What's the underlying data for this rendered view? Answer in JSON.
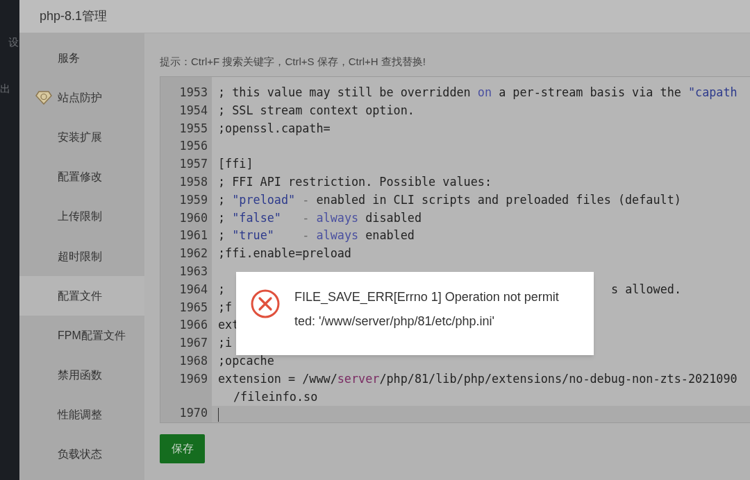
{
  "background": {
    "texts": [
      "设",
      "出"
    ]
  },
  "window": {
    "title": "php-8.1管理"
  },
  "sidebar": {
    "items": [
      {
        "label": "服务",
        "selected": false
      },
      {
        "label": "站点防护",
        "selected": false,
        "kind": "premium"
      },
      {
        "label": "安装扩展",
        "selected": false
      },
      {
        "label": "配置修改",
        "selected": false
      },
      {
        "label": "上传限制",
        "selected": false
      },
      {
        "label": "超时限制",
        "selected": false
      },
      {
        "label": "配置文件",
        "selected": true
      },
      {
        "label": "FPM配置文件",
        "selected": false
      },
      {
        "label": "禁用函数",
        "selected": false
      },
      {
        "label": "性能调整",
        "selected": false
      },
      {
        "label": "负载状态",
        "selected": false
      }
    ]
  },
  "hint": "提示：Ctrl+F 搜索关键字，Ctrl+S 保存，Ctrl+H 查找替换!",
  "editor": {
    "lines": [
      {
        "number": "1953",
        "active": false,
        "segments": [
          {
            "text": "; this value may still be overridden ",
            "kind": "plain"
          },
          {
            "text": "on",
            "kind": "keyword"
          },
          {
            "text": " a per-stream basis via the ",
            "kind": "plain"
          },
          {
            "text": "\"capath",
            "kind": "string"
          }
        ]
      },
      {
        "number": "1954",
        "active": false,
        "segments": [
          {
            "text": "; SSL stream context option.",
            "kind": "plain"
          }
        ]
      },
      {
        "number": "1955",
        "active": false,
        "segments": [
          {
            "text": ";openssl.capath=",
            "kind": "plain"
          }
        ]
      },
      {
        "number": "1956",
        "active": false
      },
      {
        "number": "1957",
        "active": false,
        "segments": [
          {
            "text": "[ffi]",
            "kind": "plain"
          }
        ]
      },
      {
        "number": "1958",
        "active": false,
        "segments": [
          {
            "text": "; FFI API restriction. Possible values:",
            "kind": "plain"
          }
        ]
      },
      {
        "number": "1959",
        "active": false,
        "segments": [
          {
            "text": "; ",
            "kind": "plain"
          },
          {
            "text": "\"preload\"",
            "kind": "string"
          },
          {
            "text": " -",
            "kind": "operator"
          },
          {
            "text": " enabled in CLI scripts and preloaded files (default)",
            "kind": "plain"
          }
        ]
      },
      {
        "number": "1960",
        "active": false,
        "segments": [
          {
            "text": "; ",
            "kind": "plain"
          },
          {
            "text": "\"false\"",
            "kind": "string"
          },
          {
            "text": "   - ",
            "kind": "operator"
          },
          {
            "text": "always",
            "kind": "keyword"
          },
          {
            "text": " disabled",
            "kind": "plain"
          }
        ]
      },
      {
        "number": "1961",
        "active": false,
        "segments": [
          {
            "text": "; ",
            "kind": "plain"
          },
          {
            "text": "\"true\"",
            "kind": "string"
          },
          {
            "text": "    - ",
            "kind": "operator"
          },
          {
            "text": "always",
            "kind": "keyword"
          },
          {
            "text": " enabled",
            "kind": "plain"
          }
        ]
      },
      {
        "number": "1962",
        "active": false,
        "segments": [
          {
            "text": ";ffi.enable=preload",
            "kind": "plain"
          }
        ]
      },
      {
        "number": "1963",
        "active": false
      },
      {
        "number": "1964",
        "active": false,
        "segments": [
          {
            "text": ";",
            "kind": "plain"
          },
          {
            "text": "s allowed.",
            "kind": "tail"
          }
        ]
      },
      {
        "number": "1965",
        "active": false,
        "segments": [
          {
            "text": ";f",
            "kind": "plain"
          }
        ]
      },
      {
        "number": "1966",
        "active": false,
        "segments": [
          {
            "text": "ext",
            "kind": "plain"
          }
        ]
      },
      {
        "number": "1967",
        "active": false,
        "segments": [
          {
            "text": ";i",
            "kind": "plain"
          }
        ]
      },
      {
        "number": "1968",
        "active": false,
        "segments": [
          {
            "text": ";opcache",
            "kind": "plain"
          }
        ]
      },
      {
        "number": "1969",
        "active": false,
        "segments": [
          {
            "text": "extension = /www/",
            "kind": "plain"
          },
          {
            "text": "server",
            "kind": "variable"
          },
          {
            "text": "/php/81/lib/php/extensions/no-debug-non-zts-2021090",
            "kind": "plain"
          }
        ],
        "continuation": "/fileinfo.so"
      },
      {
        "number": "1970",
        "active": true
      }
    ]
  },
  "save_button": "保存",
  "dialog": {
    "kind": "error",
    "message": "FILE_SAVE_ERR[Errno 1] Operation not permitted: '/www/server/php/81/etc/php.ini'"
  }
}
